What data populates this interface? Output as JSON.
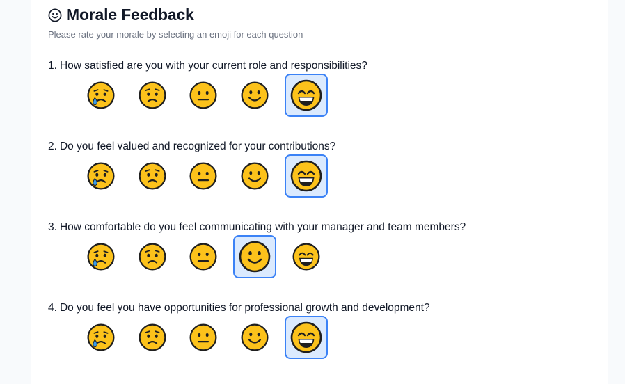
{
  "form": {
    "title": "Morale Feedback",
    "subtitle": "Please rate your morale by selecting an emoji for each question"
  },
  "options": [
    {
      "icon": "crying-face-icon"
    },
    {
      "icon": "worried-face-icon"
    },
    {
      "icon": "neutral-face-icon"
    },
    {
      "icon": "slightly-smiling-face-icon"
    },
    {
      "icon": "grinning-face-icon"
    }
  ],
  "questions": [
    {
      "number": "1.",
      "text": "How satisfied are you with your current role and responsibilities?",
      "selected": 5
    },
    {
      "number": "2.",
      "text": "Do you feel valued and recognized for your contributions?",
      "selected": 5
    },
    {
      "number": "3.",
      "text": "How comfortable do you feel communicating with your manager and team members?",
      "selected": 4
    },
    {
      "number": "4.",
      "text": "Do you feel you have opportunities for professional growth and development?",
      "selected": 5
    }
  ],
  "colors": {
    "selected_bg": "#dbeafe",
    "selected_border": "#3b82f6",
    "emoji_fill": "#fcc21b",
    "tear": "#3b9be6"
  }
}
